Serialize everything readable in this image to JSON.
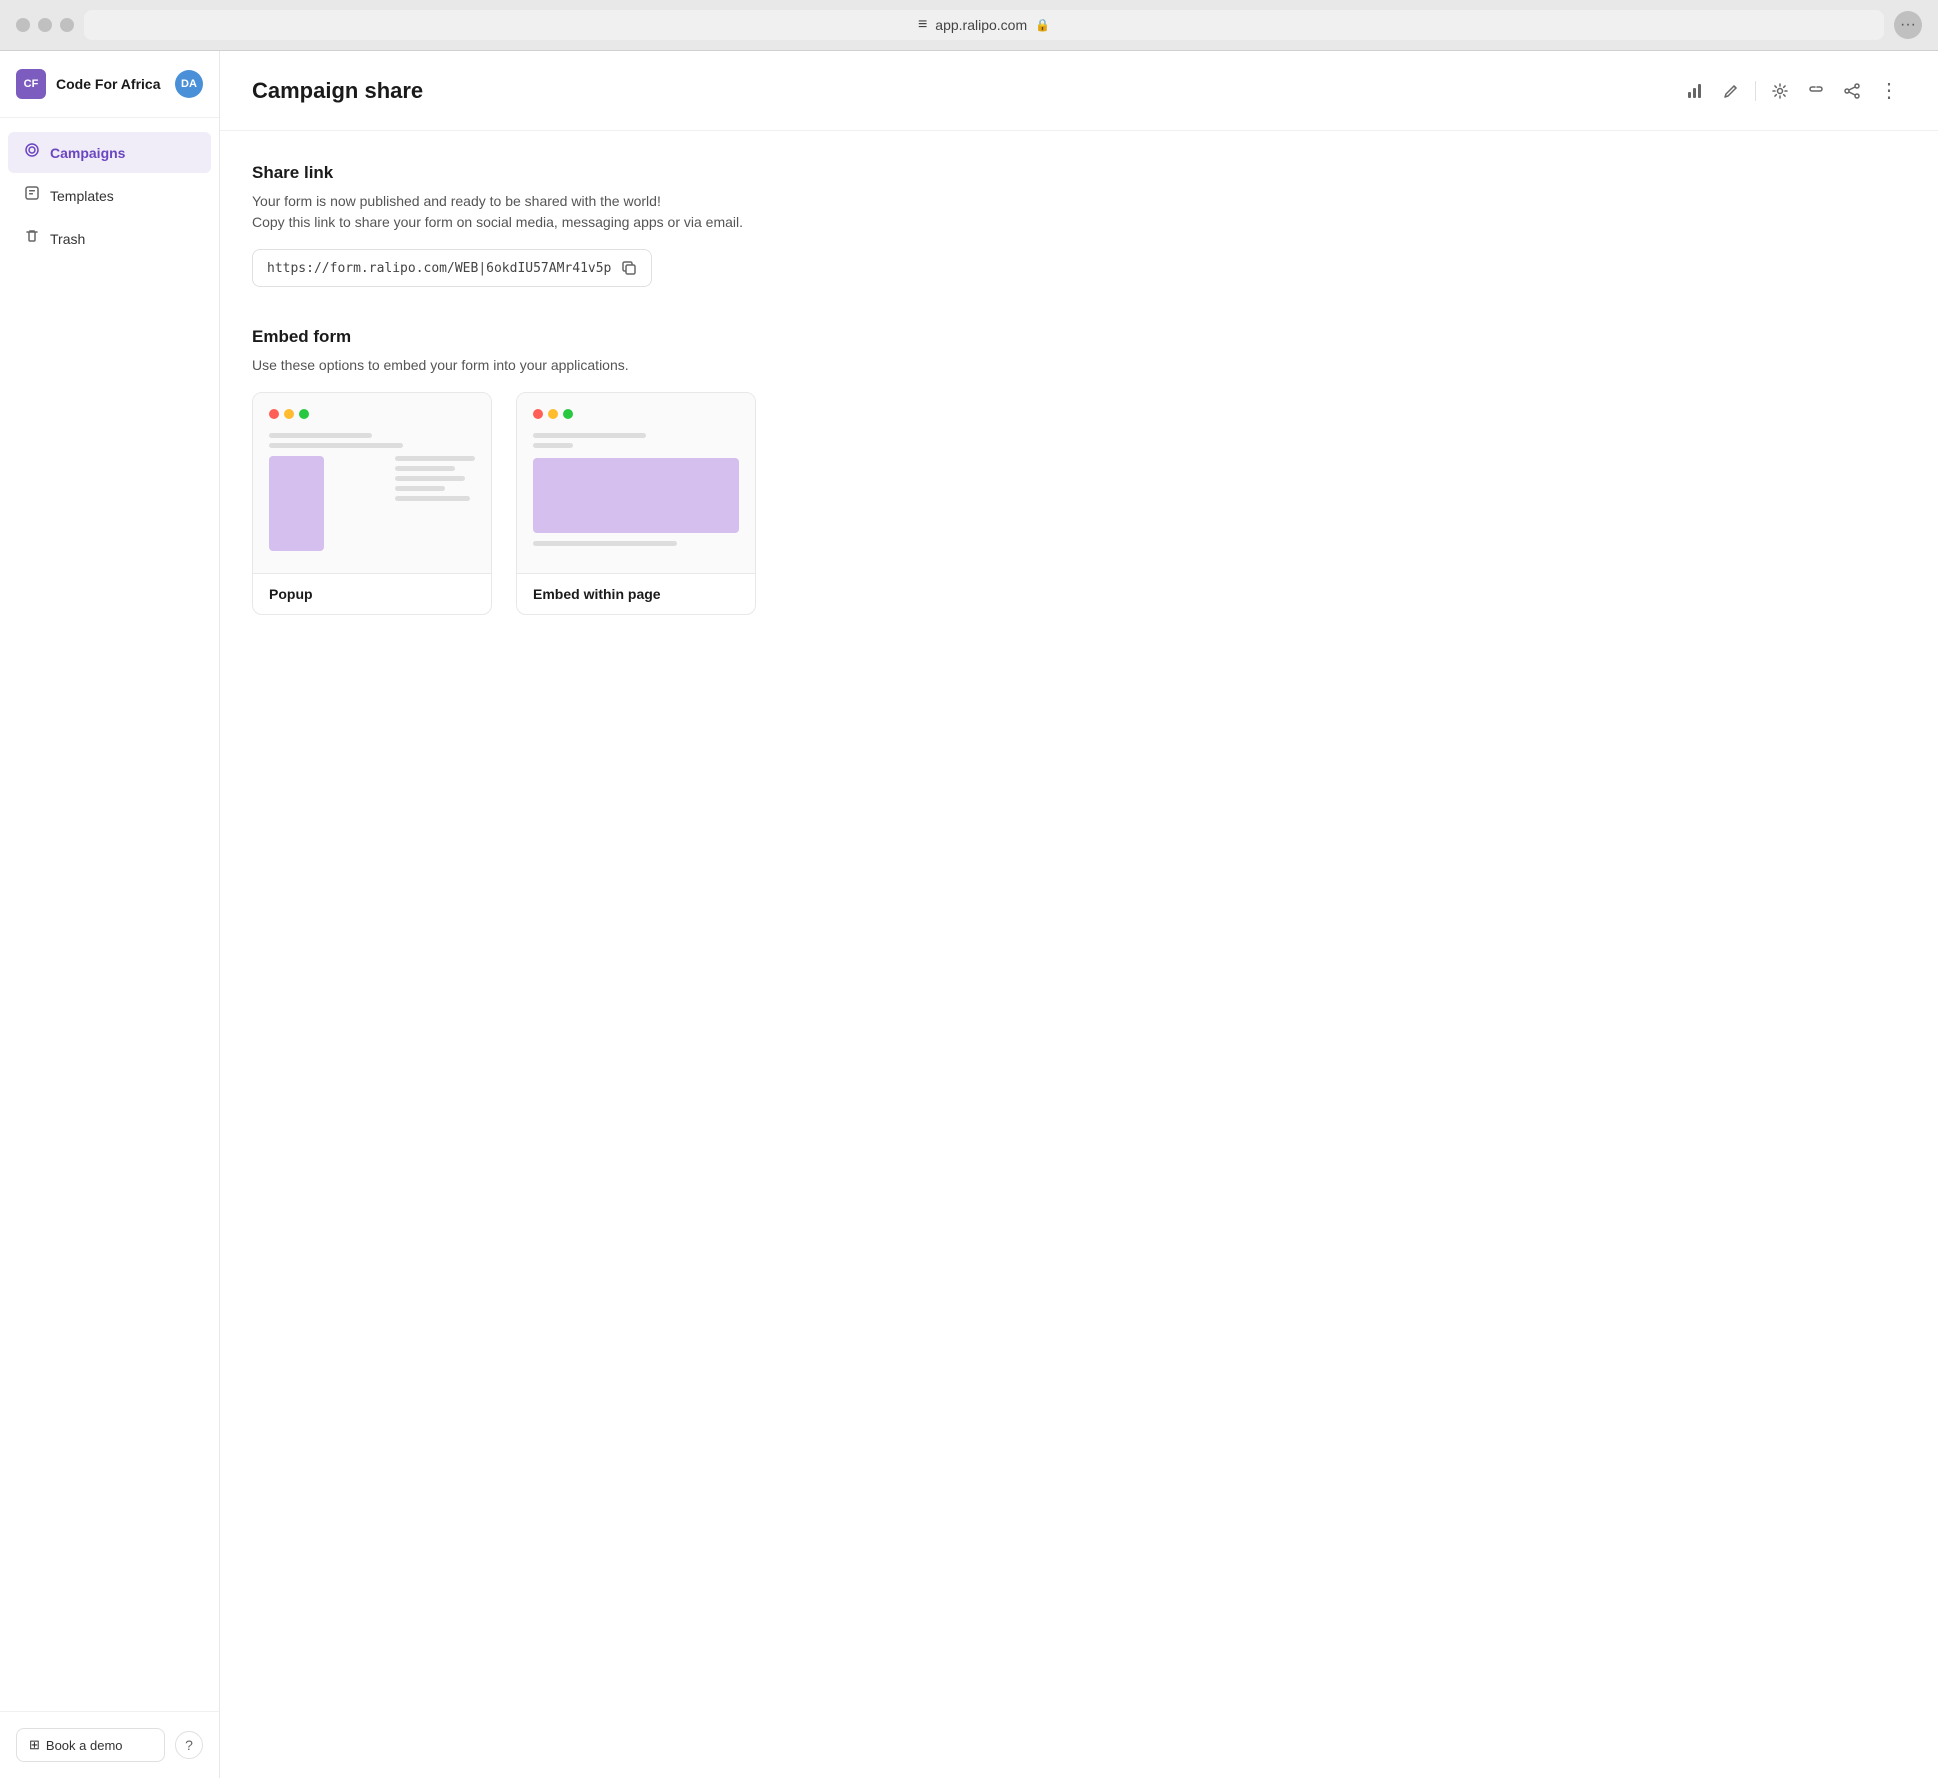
{
  "browser": {
    "address": "app.ralipo.com",
    "address_icon": "≡",
    "lock_icon": "🔒"
  },
  "sidebar": {
    "org": {
      "initials": "CF",
      "name": "Code For Africa"
    },
    "user": {
      "initials": "DA"
    },
    "nav": [
      {
        "id": "campaigns",
        "label": "Campaigns",
        "icon": "◎",
        "active": true
      },
      {
        "id": "templates",
        "label": "Templates",
        "icon": "⊡"
      },
      {
        "id": "trash",
        "label": "Trash",
        "icon": "🗑"
      }
    ],
    "book_demo_label": "Book a demo",
    "book_demo_icon": "⊞",
    "help_icon": "?"
  },
  "header": {
    "title": "Campaign share",
    "actions": [
      {
        "id": "analytics",
        "icon": "📊",
        "label": "analytics"
      },
      {
        "id": "edit",
        "icon": "✏️",
        "label": "edit"
      },
      {
        "id": "settings",
        "icon": "⚙️",
        "label": "settings"
      },
      {
        "id": "link",
        "icon": "🔗",
        "label": "share-link"
      },
      {
        "id": "share",
        "icon": "↗",
        "label": "share"
      }
    ],
    "more_icon": "⋮"
  },
  "content": {
    "share_link": {
      "title": "Share link",
      "description": "Your form is now published and ready to be shared with the world!\nCopy this link to share your form on social media, messaging apps or via email.",
      "url": "https://form.ralipo.com/WEB|6okdIU57AMr41v5p",
      "copy_icon": "⧉"
    },
    "embed_form": {
      "title": "Embed form",
      "description": "Use these options to embed your form into your applications.",
      "options": [
        {
          "id": "popup",
          "label": "Popup",
          "type": "popup"
        },
        {
          "id": "embed",
          "label": "Embed within page",
          "type": "embed"
        }
      ]
    }
  }
}
